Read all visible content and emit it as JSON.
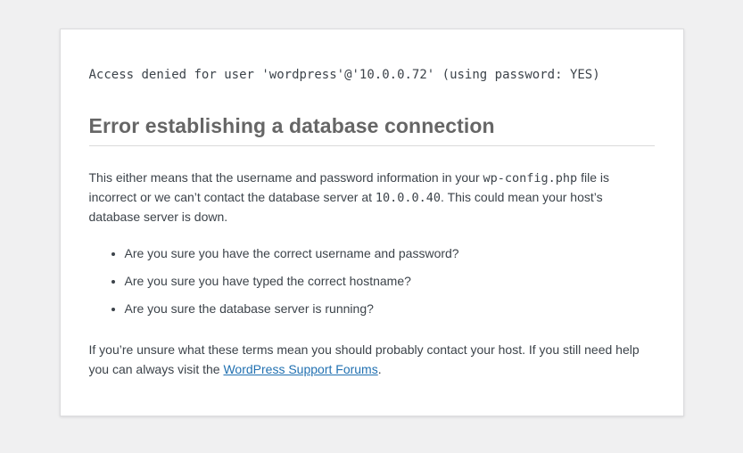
{
  "page": {
    "background_color": "#f0f0f1",
    "card_background_color": "#ffffff",
    "heading_color": "#666666",
    "text_color": "#3c434a",
    "link_color": "#2271b1"
  },
  "error": {
    "db_message": "Access denied for user 'wordpress'@'10.0.0.72' (using password: YES)",
    "title": "Error establishing a database connection",
    "paragraph1": {
      "text_before_code1": "This either means that the username and password information in your ",
      "code1": "wp-config.php",
      "text_between_codes": " file is incorrect or we can’t contact the database server at ",
      "code2": "10.0.0.40",
      "text_after_code2": ". This could mean your host’s database server is down."
    },
    "checklist": [
      "Are you sure you have the correct username and password?",
      "Are you sure you have typed the correct hostname?",
      "Are you sure the database server is running?"
    ],
    "paragraph2": {
      "text_before_link": "If you’re unsure what these terms mean you should probably contact your host. If you still need help you can always visit the ",
      "link_text": "WordPress Support Forums",
      "text_after_link": "."
    }
  }
}
